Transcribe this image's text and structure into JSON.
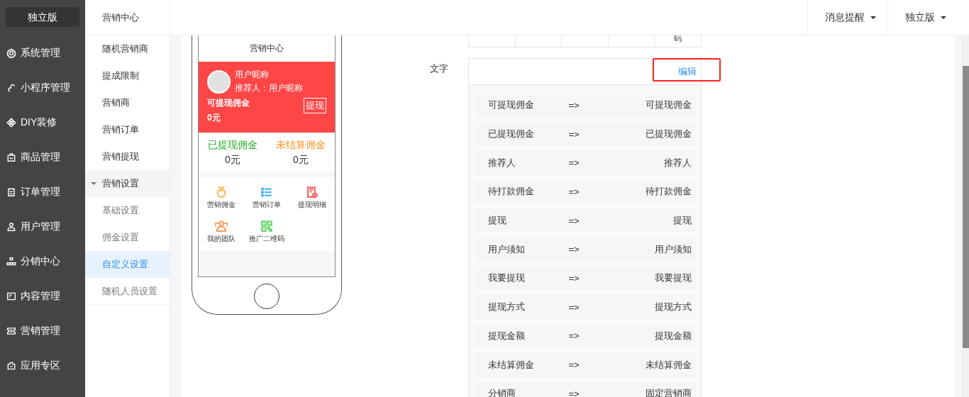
{
  "brand": {
    "label": "独立版"
  },
  "main_menu": [
    {
      "label": "系统管理"
    },
    {
      "label": "小程序管理"
    },
    {
      "label": "DIY装修"
    },
    {
      "label": "商品管理"
    },
    {
      "label": "订单管理"
    },
    {
      "label": "用户管理"
    },
    {
      "label": "分销中心"
    },
    {
      "label": "内容管理"
    },
    {
      "label": "营销管理"
    },
    {
      "label": "应用专区"
    }
  ],
  "sub_menu": {
    "title": "营销中心",
    "items": [
      {
        "label": "随机营销商",
        "selected": false
      },
      {
        "label": "提成限制",
        "selected": false
      },
      {
        "label": "营销商",
        "selected": false
      },
      {
        "label": "营销订单",
        "selected": false
      },
      {
        "label": "营销提现",
        "selected": false
      },
      {
        "label": "营销设置",
        "selected": false,
        "expanded": true,
        "children": [
          {
            "label": "基础设置",
            "selected": false
          },
          {
            "label": "佣金设置",
            "selected": false
          },
          {
            "label": "自定义设置",
            "selected": true
          },
          {
            "label": "随机人员设置",
            "selected": false
          }
        ]
      }
    ]
  },
  "topbar": {
    "menus": [
      {
        "label": "消息提醒"
      },
      {
        "label": "独立版"
      }
    ]
  },
  "phone": {
    "title": "营销中心",
    "nickname": "用户昵称",
    "referrer": "推荐人：用户昵称",
    "withdrawable_label": "可提现佣金",
    "withdrawable_value": "0元",
    "withdraw_button": "提现",
    "stats": [
      {
        "label": "已提现佣金",
        "value": "0元",
        "color": "#22aa22"
      },
      {
        "label": "未结算佣金",
        "value": "0元",
        "color": "#ff8c1a"
      }
    ],
    "menu": [
      {
        "label": "营销佣金",
        "color": "#f5c26b"
      },
      {
        "label": "营销订单",
        "color": "#4fb3f0"
      },
      {
        "label": "提现明细",
        "color": "#f06a6a"
      },
      {
        "label": "我的团队",
        "color": "#f5a26b"
      },
      {
        "label": "推广二维码",
        "color": "#6cd66c"
      }
    ]
  },
  "partial_table": {
    "cells": [
      "",
      "",
      "",
      "",
      "码"
    ]
  },
  "text_settings": {
    "label": "文字",
    "edit_link": "编辑",
    "rows": [
      {
        "original": "可提现佣金",
        "arrow": "=>",
        "custom": "可提现佣金"
      },
      {
        "original": "已提现佣金",
        "arrow": "=>",
        "custom": "已提现佣金"
      },
      {
        "original": "推荐人",
        "arrow": "=>",
        "custom": "推荐人"
      },
      {
        "original": "待打款佣金",
        "arrow": "=>",
        "custom": "待打款佣金"
      },
      {
        "original": "提现",
        "arrow": "=>",
        "custom": "提现"
      },
      {
        "original": "用户须知",
        "arrow": "=>",
        "custom": "用户须知"
      },
      {
        "original": "我要提现",
        "arrow": "=>",
        "custom": "我要提现"
      },
      {
        "original": "提现方式",
        "arrow": "=>",
        "custom": "提现方式"
      },
      {
        "original": "提现金额",
        "arrow": "=>",
        "custom": "提现金额"
      },
      {
        "original": "未结算佣金",
        "arrow": "=>",
        "custom": "未结算佣金"
      },
      {
        "original": "分销商",
        "arrow": "=>",
        "custom": "固定营销商"
      }
    ]
  }
}
